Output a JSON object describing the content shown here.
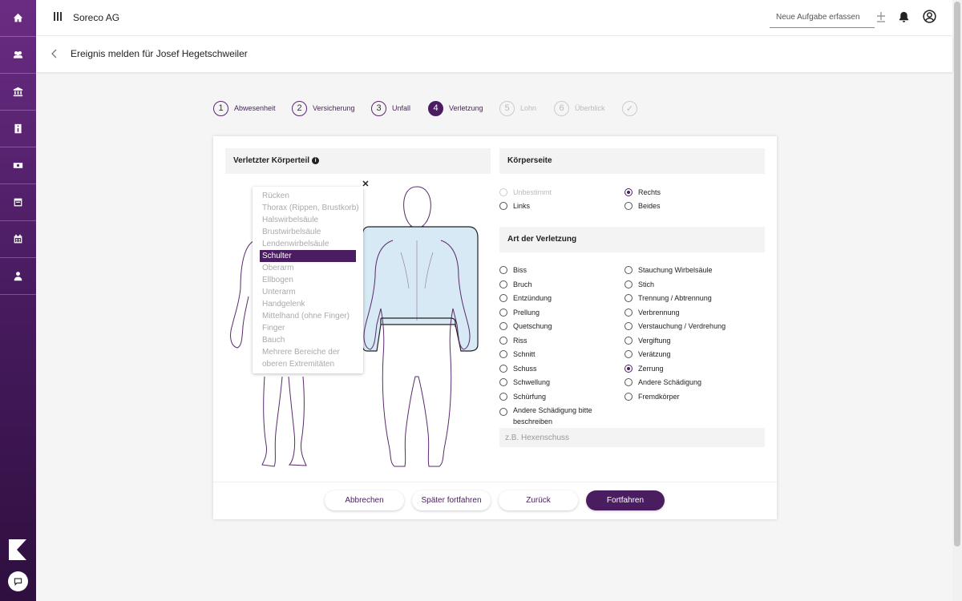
{
  "app": {
    "company": "Soreco AG"
  },
  "topbar": {
    "task_placeholder": "Neue Aufgabe erfassen"
  },
  "sidebar": {
    "items": [
      "home-icon",
      "team-icon",
      "bank-icon",
      "info-card-icon",
      "money-icon",
      "calendar-week-icon",
      "calendar-icon",
      "person-icon"
    ]
  },
  "header": {
    "title": "Ereignis melden für Josef Hegetschweiler"
  },
  "stepper": [
    {
      "num": "1",
      "label": "Abwesenheit",
      "state": "done"
    },
    {
      "num": "2",
      "label": "Versicherung",
      "state": "done"
    },
    {
      "num": "3",
      "label": "Unfall",
      "state": "done"
    },
    {
      "num": "4",
      "label": "Verletzung",
      "state": "active"
    },
    {
      "num": "5",
      "label": "Lohn",
      "state": "disabled"
    },
    {
      "num": "6",
      "label": "Überblick",
      "state": "disabled"
    },
    {
      "num": "✓",
      "label": "",
      "state": "disabled"
    }
  ],
  "body_part": {
    "title": "Verletzter Körperteil",
    "options": [
      "Rücken",
      "Thorax (Rippen, Brustkorb)",
      "Halswirbelsäule",
      "Brustwirbelsäule",
      "Lendenwirbelsäule",
      "Schulter",
      "Oberarm",
      "Ellbogen",
      "Unterarm",
      "Handgelenk",
      "Mittelhand (ohne Finger)",
      "Finger",
      "Bauch",
      "Mehrere Bereiche der",
      "oberen Extremitäten"
    ],
    "selected": "Schulter"
  },
  "body_side": {
    "title": "Körperseite",
    "options": [
      {
        "label": "Unbestimmt",
        "state": "disabled"
      },
      {
        "label": "Rechts",
        "state": "checked"
      },
      {
        "label": "Links",
        "state": ""
      },
      {
        "label": "Beides",
        "state": ""
      }
    ]
  },
  "injury_type": {
    "title": "Art der Verletzung",
    "left": [
      "Biss",
      "Bruch",
      "Entzündung",
      "Prellung",
      "Quetschung",
      "Riss",
      "Schnitt",
      "Schuss",
      "Schwellung",
      "Schürfung"
    ],
    "right": [
      "Stauchung Wirbelsäule",
      "Stich",
      "Trennung / Abtrennung",
      "Verbrennung",
      "Verstauchung / Verdrehung",
      "Vergiftung",
      "Verätzung",
      "Zerrung",
      "Andere Schädigung",
      "Fremdkörper"
    ],
    "checked": "Zerrung",
    "other_label_1": "Andere Schädigung bitte",
    "other_label_2": "beschreiben",
    "other_placeholder": "z.B. Hexenschuss"
  },
  "buttons": {
    "cancel": "Abbrechen",
    "later": "Später fortfahren",
    "back": "Zurück",
    "next": "Fortfahren"
  },
  "colors": {
    "brand": "#4a1d60",
    "sidebar_top": "#6a2c82",
    "highlight": "#d6e9f4"
  }
}
